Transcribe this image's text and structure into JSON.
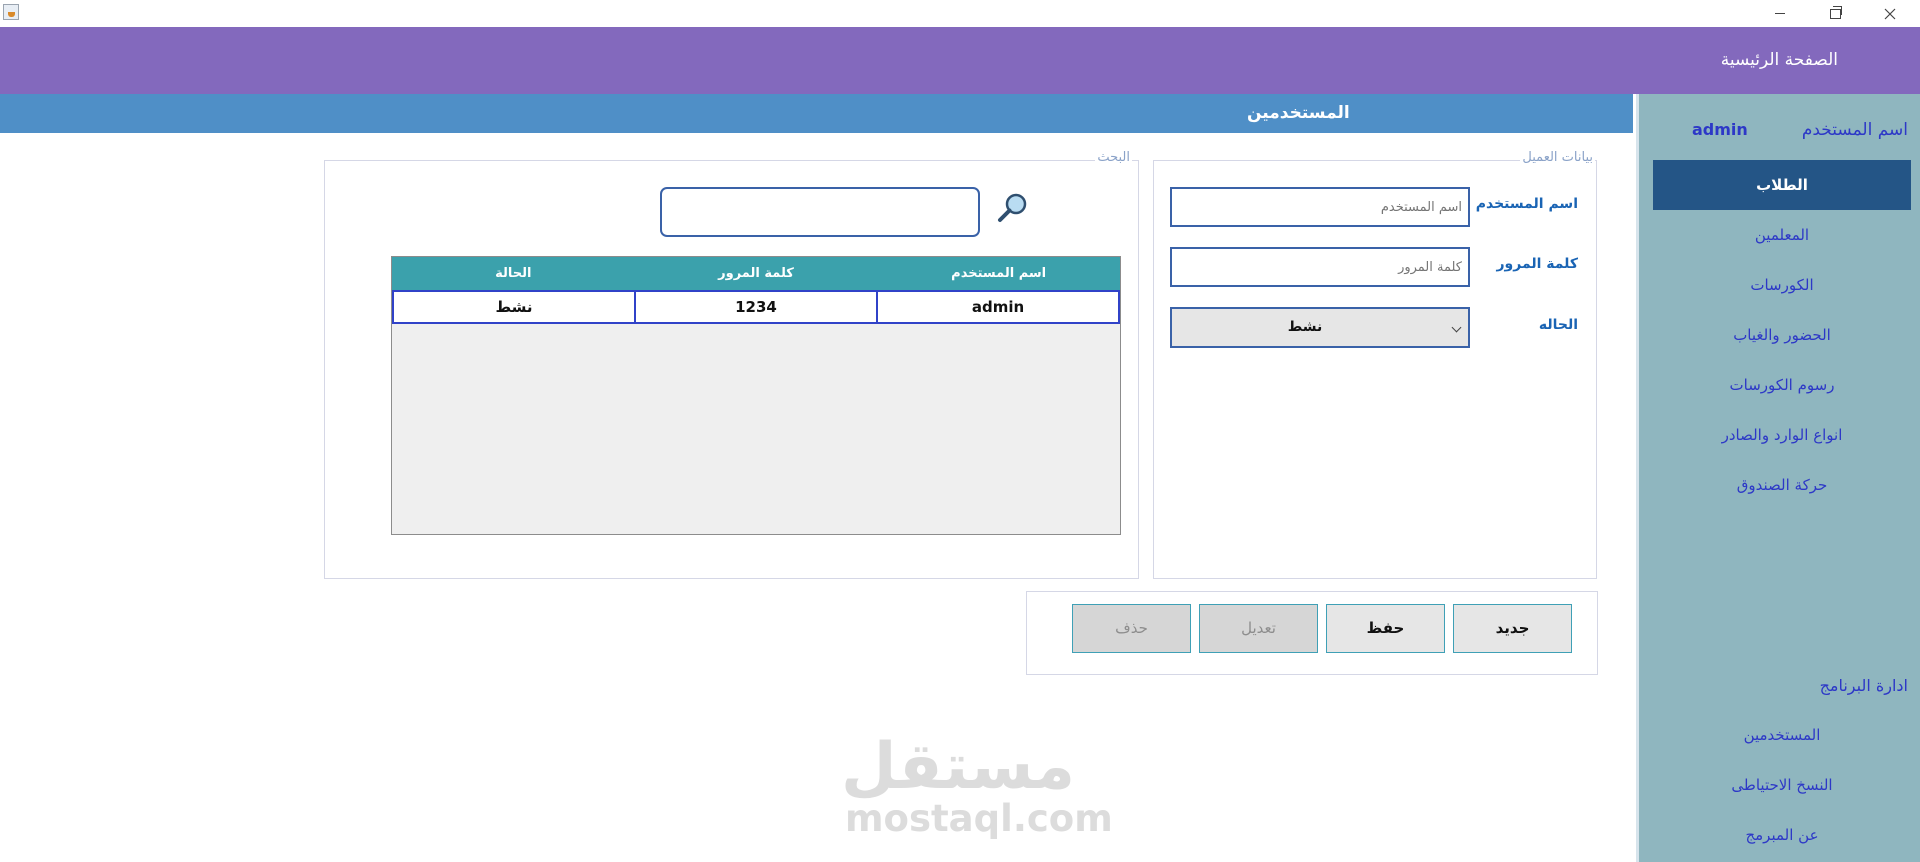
{
  "header": {
    "home_label": "الصفحة الرئيسية"
  },
  "page": {
    "title": "المستخدمين"
  },
  "sidebar": {
    "user_label": "اسم المستخدم",
    "user_value": "admin",
    "items": [
      {
        "label": "الطلاب"
      },
      {
        "label": "المعلمين"
      },
      {
        "label": "الكورسات"
      },
      {
        "label": "الحضور والغياب"
      },
      {
        "label": "رسوم الكورسات"
      },
      {
        "label": "انواع الوارد والصادر"
      },
      {
        "label": "حركة الصندوق"
      }
    ],
    "section_label": "ادارة البرنامج",
    "admin_items": [
      {
        "label": "المستخدمين"
      },
      {
        "label": "النسخ الاحتياطى"
      },
      {
        "label": "عن المبرمج"
      }
    ]
  },
  "form": {
    "legend": "بيانات العميل",
    "username_label": "اسم المستخدم",
    "username_placeholder": "اسم المستخدم",
    "password_label": "كلمة المرور",
    "password_placeholder": "كلمة المرور",
    "status_label": "الحاله",
    "status_value": "نشط"
  },
  "search": {
    "legend": "البحث",
    "value": ""
  },
  "table": {
    "headers": [
      "اسم المستخدم",
      "كلمة المرور",
      "الحالة"
    ],
    "rows": [
      [
        "admin",
        "1234",
        "نشط"
      ]
    ]
  },
  "buttons": {
    "new": "جديد",
    "save": "حفظ",
    "edit": "تعديل",
    "delete": "حذف"
  },
  "watermark": {
    "arabic": "مستقل",
    "latin": "mostaql.com"
  },
  "colors": {
    "header": "#8369bd",
    "page_bar": "#4f8fc7",
    "sidebar": "#8fb6bf",
    "sidebar_active": "#245586",
    "table_header": "#3ba1ac"
  }
}
